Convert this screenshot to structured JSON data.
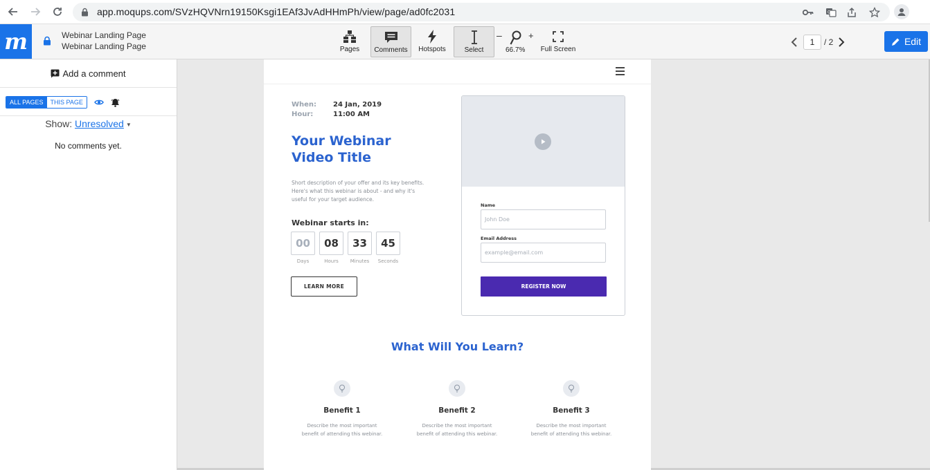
{
  "browser": {
    "url": "app.moqups.com/SVzHQVNrn19150Ksgi1EAf3JvAdHHmPh/view/page/ad0fc2031"
  },
  "app": {
    "logo": "m",
    "project_name": "Webinar Landing Page",
    "page_name": "Webinar Landing Page",
    "toolbar": {
      "pages": "Pages",
      "comments": "Comments",
      "hotspots": "Hotspots",
      "select": "Select",
      "zoom_minus": "–",
      "zoom_plus": "+",
      "zoom_level": "66.7%",
      "fullscreen": "Full Screen"
    },
    "pager": {
      "current": "1",
      "total": "/ 2"
    },
    "edit_label": "Edit",
    "accent": "#1a73e8"
  },
  "comments_panel": {
    "add_comment": "Add a comment",
    "tab_all": "ALL PAGES",
    "tab_this": "THIS PAGE",
    "show_label": "Show:",
    "show_value": "Unresolved",
    "empty": "No comments yet."
  },
  "mock": {
    "when_label": "When:",
    "when_value": "24 Jan, 2019",
    "hour_label": "Hour:",
    "hour_value": "11:00 AM",
    "title_line1": "Your Webinar",
    "title_line2": "Video Title",
    "description": "Short description of your offer and its key benefits. Here's what this webinar is about - and why it's useful for your target audience.",
    "starts_label": "Webinar starts in:",
    "countdown": [
      {
        "value": "00",
        "label": "Days"
      },
      {
        "value": "08",
        "label": "Hours"
      },
      {
        "value": "33",
        "label": "Minutes"
      },
      {
        "value": "45",
        "label": "Seconds"
      }
    ],
    "learn_more": "LEARN MORE",
    "form": {
      "name_label": "Name",
      "name_placeholder": "John Doe",
      "email_label": "Email Address",
      "email_placeholder": "example@email.com",
      "register": "REGISTER NOW"
    },
    "learn_title": "What Will You Learn?",
    "benefits": [
      {
        "title": "Benefit 1",
        "desc1": "Describe the most important",
        "desc2": "benefit of attending this webinar."
      },
      {
        "title": "Benefit 2",
        "desc1": "Describe the most important",
        "desc2": "benefit of attending this webinar."
      },
      {
        "title": "Benefit 3",
        "desc1": "Describe the most important",
        "desc2": "benefit of attending this webinar."
      }
    ],
    "colors": {
      "heading": "#2b63cf",
      "register": "#4a2ab0"
    }
  }
}
